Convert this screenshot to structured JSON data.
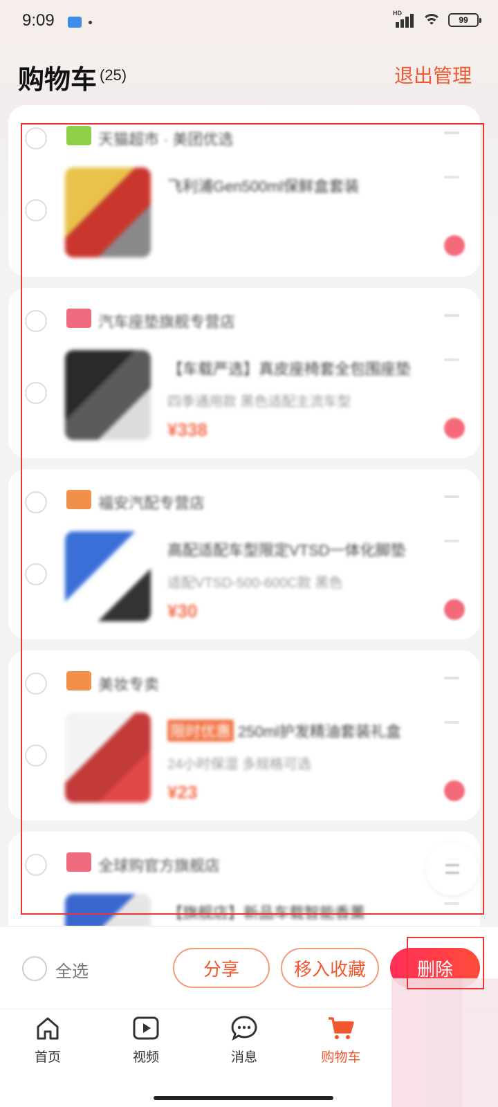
{
  "status_bar": {
    "time": "9:09",
    "signal_label": "HD",
    "battery": "99"
  },
  "header": {
    "title": "购物车",
    "count": "(25)",
    "exit_manage": "退出管理"
  },
  "cart": {
    "items": [
      {
        "shop_name": "天猫超市 · 美团优选",
        "title": "飞利浦Gen500ml保鲜盒套装",
        "subtitle": "",
        "price": "",
        "promo": "",
        "shop_icon_color": "#8fd04a",
        "thumb_colors": [
          "#e8c24a",
          "#c9362e",
          "#8a8a8a"
        ]
      },
      {
        "shop_name": "汽车座垫旗舰专营店",
        "title": "【车载严选】真皮座椅套全包围座垫",
        "subtitle": "四季通用款 黑色适配主流车型",
        "price": "¥338",
        "promo": "",
        "shop_icon_color": "#ef6b7d",
        "thumb_colors": [
          "#2a2a2a",
          "#5a5a5a",
          "#dcdcdc"
        ]
      },
      {
        "shop_name": "福安汽配专营店",
        "title": "高配适配车型限定VTSD一体化脚垫",
        "subtitle": "适配VTSD-500-600C款 黑色",
        "price": "¥30",
        "promo": "",
        "shop_icon_color": "#f0904a",
        "thumb_colors": [
          "#3a6fd8",
          "#ffffff",
          "#333333"
        ]
      },
      {
        "shop_name": "美妆专卖",
        "title": "250ml护发精油套装礼盒",
        "subtitle": "24小时保湿 多规格可选",
        "price": "¥23",
        "promo": "限时优惠",
        "shop_icon_color": "#f0904a",
        "thumb_colors": [
          "#f3f3f3",
          "#c23a3a",
          "#e04848"
        ]
      },
      {
        "shop_name": "全球购官方旗舰店",
        "title": "【旗舰店】新品车载智能香薰",
        "subtitle": "",
        "price": "",
        "promo": "",
        "shop_icon_color": "#ef6b7d",
        "thumb_colors": [
          "#3a66d0",
          "#e6e6e6",
          "#d84a4a"
        ]
      }
    ]
  },
  "action_bar": {
    "select_all": "全选",
    "share": "分享",
    "move_to_favorites": "移入收藏",
    "delete": "删除"
  },
  "tab_bar": {
    "tabs": [
      {
        "label": "首页",
        "icon": "home-icon"
      },
      {
        "label": "视频",
        "icon": "video-icon"
      },
      {
        "label": "消息",
        "icon": "message-icon"
      },
      {
        "label": "购物车",
        "icon": "cart-icon"
      }
    ],
    "active_index": 3
  },
  "colors": {
    "accent": "#f2582f",
    "delete_gradient_start": "#ff2f58",
    "delete_gradient_end": "#ff4c3a",
    "highlight": "#e33333"
  }
}
